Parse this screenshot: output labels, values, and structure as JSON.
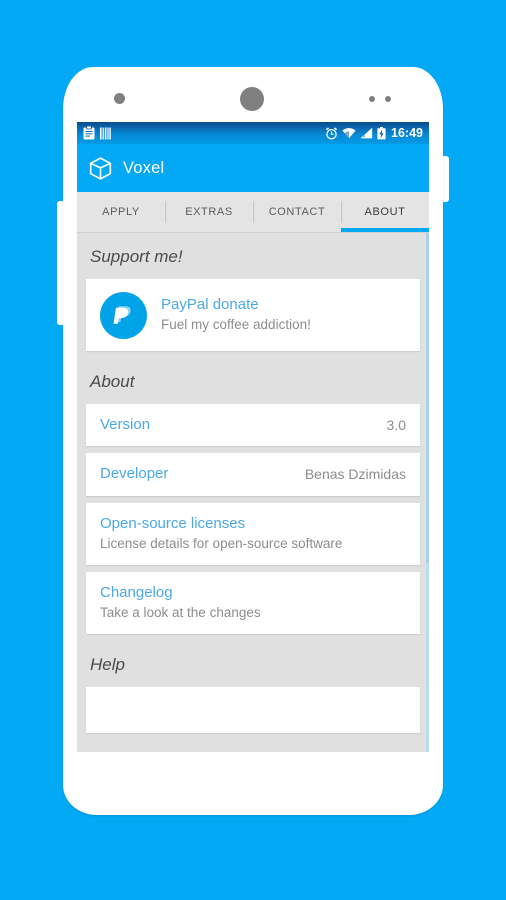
{
  "device": {
    "hardware": {
      "camera": "camera-lens",
      "speaker": "earpiece-speaker",
      "sensors": [
        "sensor-dot-1",
        "sensor-dot-2"
      ],
      "volume_button": "volume-rocker",
      "power_button": "power-button"
    }
  },
  "colors": {
    "background": "#03a9f4",
    "accent": "#03a9f4",
    "status_bar_dark": "#0a4b8c",
    "link_blue": "#4aa8e8",
    "secondary_text": "#8d8d8d",
    "list_background": "#e0e0e0",
    "card": "#ffffff",
    "paypal_blue": "#00a3e8"
  },
  "status_bar": {
    "left_icons": [
      "clipboard-icon",
      "barcode-icon"
    ],
    "right_icons": [
      "alarm-icon",
      "wifi-icon",
      "signal-icon",
      "battery-charging-icon"
    ],
    "clock": "16:49"
  },
  "action_bar": {
    "icon": "voxel-cube-icon",
    "title": "Voxel"
  },
  "tabs": [
    {
      "label": "APPLY",
      "active": false
    },
    {
      "label": "EXTRAS",
      "active": false
    },
    {
      "label": "CONTACT",
      "active": false
    },
    {
      "label": "ABOUT",
      "active": true
    }
  ],
  "sections": [
    {
      "header": "Support me!",
      "items": [
        {
          "icon": "paypal-icon",
          "title": "PayPal donate",
          "subtitle": "Fuel my coffee addiction!"
        }
      ]
    },
    {
      "header": "About",
      "items": [
        {
          "title": "Version",
          "value": "3.0"
        },
        {
          "title": "Developer",
          "value": "Benas Dzimidas"
        },
        {
          "title": "Open-source licenses",
          "subtitle": "License details for open-source software"
        },
        {
          "title": "Changelog",
          "subtitle": "Take a look at the changes"
        }
      ]
    },
    {
      "header": "Help",
      "items": []
    }
  ]
}
